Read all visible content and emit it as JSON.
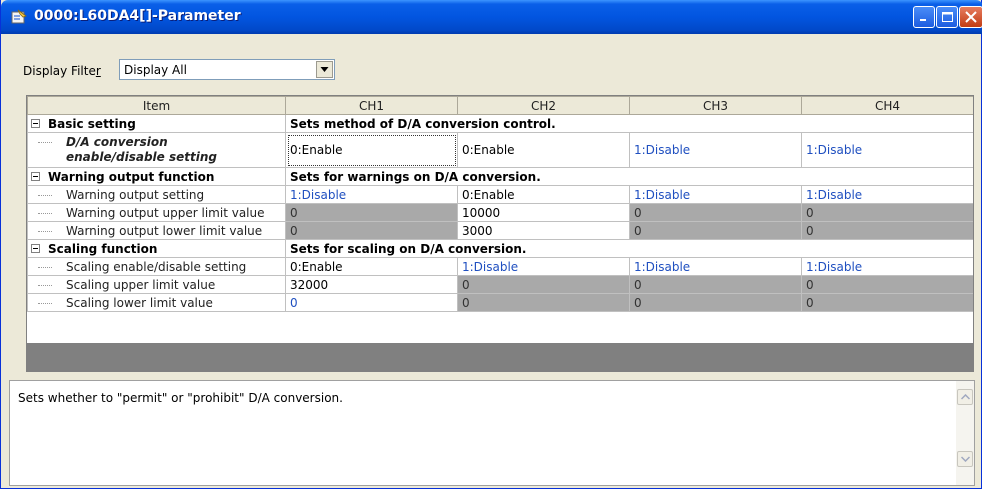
{
  "window": {
    "title": "0000:L60DA4[]-Parameter",
    "colors": {
      "titlebar": "#0255e0",
      "gray_cell": "#a9a9a9",
      "blue_text": "#1f4fc0"
    },
    "icons": [
      "parameter-icon",
      "minimize-icon",
      "maximize-icon",
      "close-icon"
    ]
  },
  "filter": {
    "label_prefix": "Display Filte",
    "label_underlined": "r",
    "selected": "Display All"
  },
  "grid": {
    "headers": [
      "Item",
      "CH1",
      "CH2",
      "CH3",
      "CH4"
    ],
    "groups": [
      {
        "label": "Basic setting",
        "description": "Sets method of D/A conversion control.",
        "rows": [
          {
            "label_line1": "D/A conversion",
            "label_line2": "enable/disable setting",
            "values": [
              "0:Enable",
              "0:Enable",
              "1:Disable",
              "1:Disable"
            ]
          }
        ]
      },
      {
        "label": "Warning output function",
        "description": "Sets for warnings on D/A conversion.",
        "rows": [
          {
            "label": "Warning output setting",
            "values": [
              "1:Disable",
              "0:Enable",
              "1:Disable",
              "1:Disable"
            ]
          },
          {
            "label": "Warning output upper limit value",
            "values": [
              "0",
              "10000",
              "0",
              "0"
            ]
          },
          {
            "label": "Warning output lower limit value",
            "values": [
              "0",
              "3000",
              "0",
              "0"
            ]
          }
        ]
      },
      {
        "label": "Scaling function",
        "description": "Sets for scaling on D/A conversion.",
        "rows": [
          {
            "label": "Scaling enable/disable setting",
            "values": [
              "0:Enable",
              "1:Disable",
              "1:Disable",
              "1:Disable"
            ]
          },
          {
            "label": "Scaling upper limit value",
            "values": [
              "32000",
              "0",
              "0",
              "0"
            ]
          },
          {
            "label": "Scaling lower limit value",
            "values": [
              "0",
              "0",
              "0",
              "0"
            ]
          }
        ]
      }
    ]
  },
  "description_panel": {
    "text": "Sets whether to \"permit\" or \"prohibit\" D/A conversion."
  }
}
